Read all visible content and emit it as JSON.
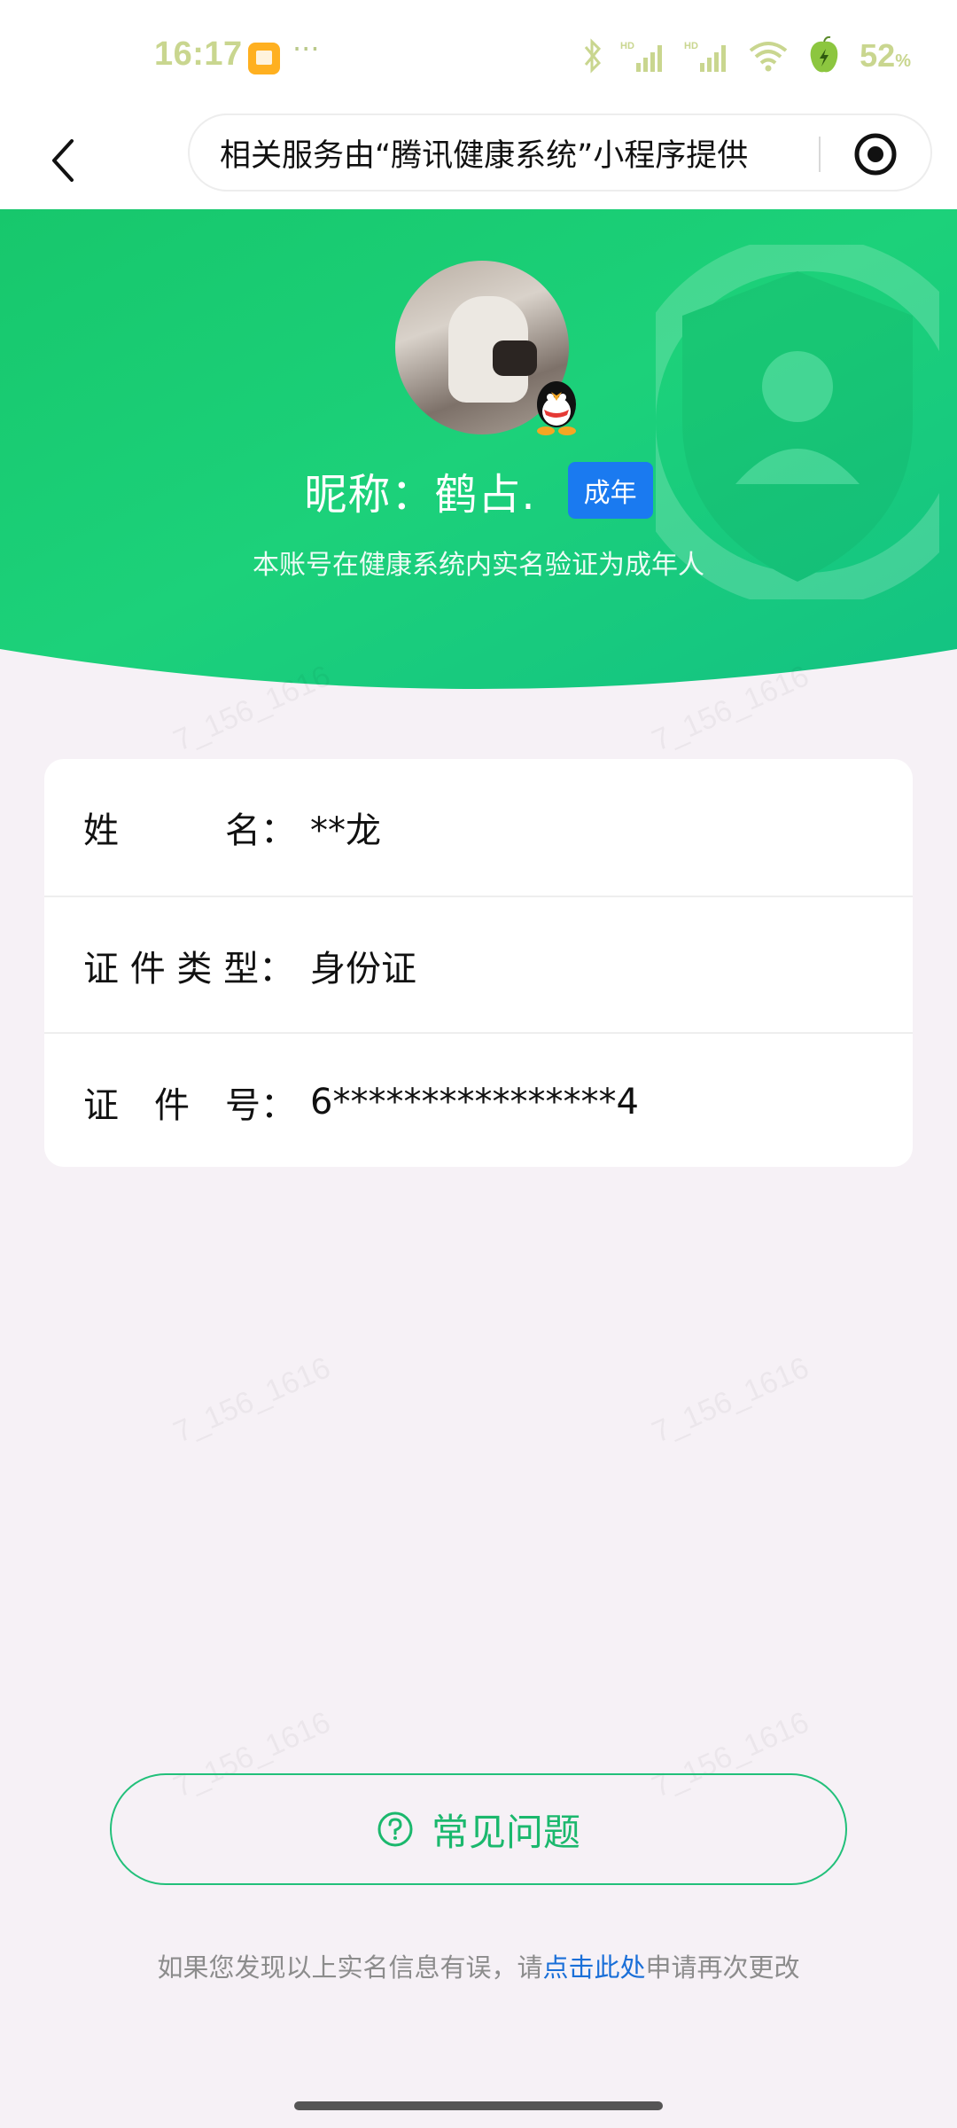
{
  "status_bar": {
    "time": "16:17",
    "more": "···",
    "battery_percent": "52",
    "battery_unit": "%"
  },
  "title_bar": {
    "service_text": "相关服务由“腾讯健康系统”小程序提供"
  },
  "profile": {
    "nickname": "昵称：鹤占.",
    "badge": "成年",
    "verify_text": "本账号在健康系统内实名验证为成年人"
  },
  "info": {
    "rows": [
      {
        "label": "姓　　　名：",
        "value": "**龙"
      },
      {
        "label": "证 件 类 型：",
        "value": "身份证"
      },
      {
        "label": "证　件　号：",
        "value": "6****************4"
      }
    ]
  },
  "faq": {
    "label": "常见问题"
  },
  "footer": {
    "prefix": "如果您发现以上实名信息有误，请",
    "link": "点击此处",
    "suffix": "申请再次更改"
  },
  "colors": {
    "primary_green": "#1bd37a",
    "badge_blue": "#1a7af0",
    "link_blue": "#1a6fd8"
  },
  "icons": [
    "back-arrow-icon",
    "record-icon",
    "bluetooth-icon",
    "signal-icon",
    "wifi-icon",
    "battery-icon",
    "qq-icon",
    "shield-icon",
    "question-icon"
  ]
}
